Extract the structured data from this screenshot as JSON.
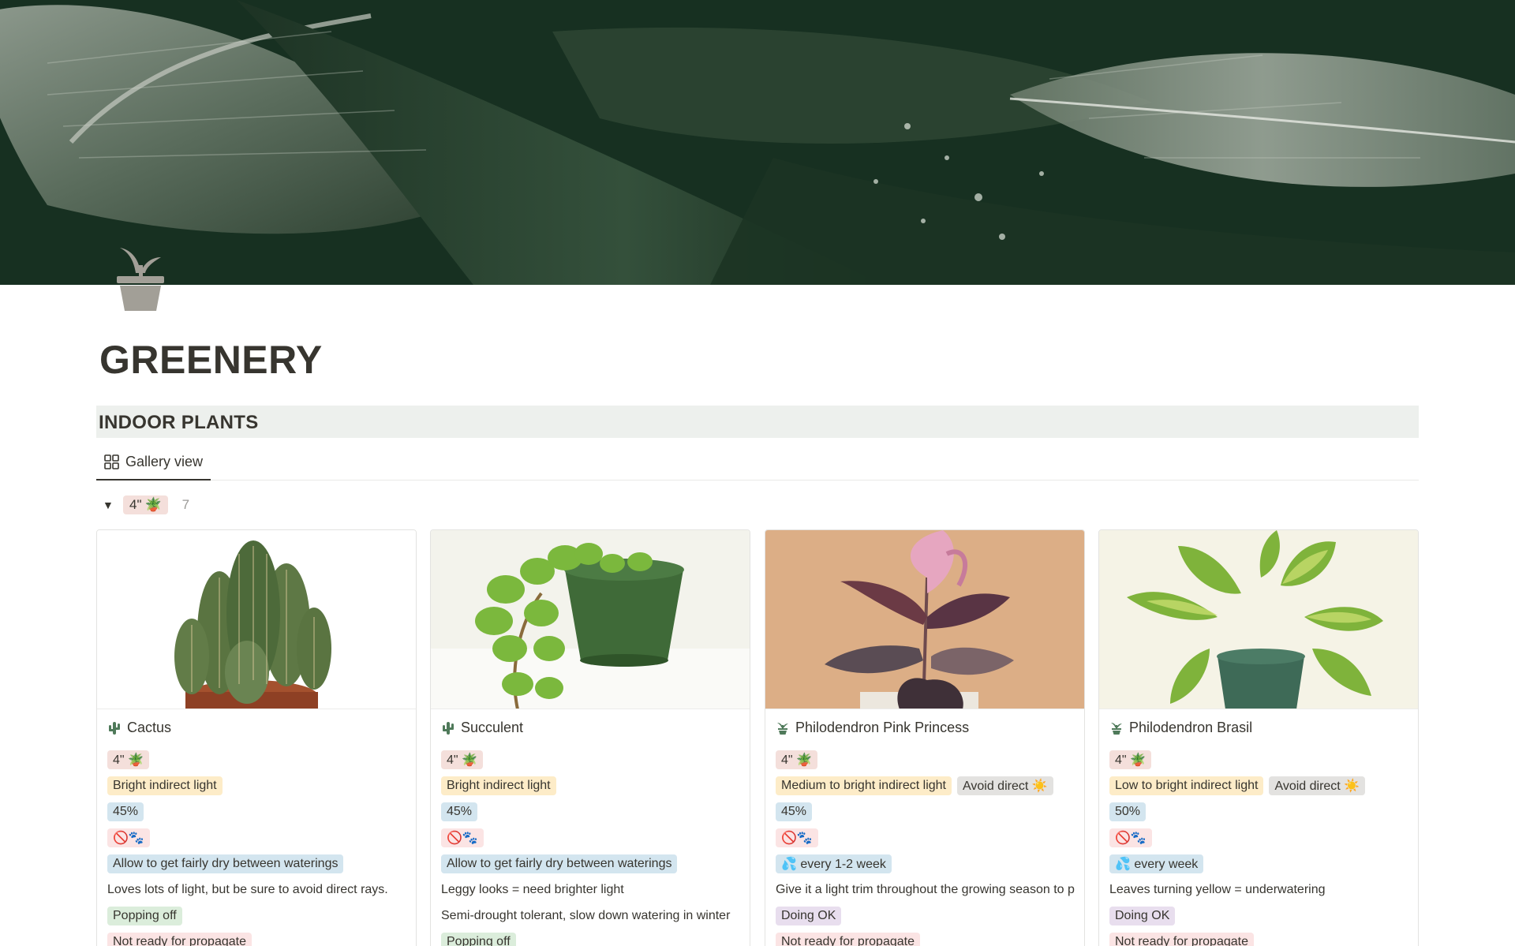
{
  "page": {
    "title": "GREENERY",
    "icon": "potted-plant-icon"
  },
  "section": {
    "heading": "INDOOR PLANTS"
  },
  "view": {
    "tab_label": "Gallery view",
    "tab_icon": "gallery-grid-icon"
  },
  "group": {
    "label": "4\"",
    "emoji": "🪴",
    "count": "7"
  },
  "cards": [
    {
      "name": "Cactus",
      "icon": "cactus-icon",
      "size": "4\" 🪴",
      "light": "Bright indirect light",
      "humidity": "45%",
      "pets": "🚫🐾",
      "water": "Allow to get fairly dry between waterings",
      "note1": "Loves lots of light, but be sure to avoid direct rays.",
      "status": "Popping off",
      "propagate": "Not ready for propagate"
    },
    {
      "name": "Succulent",
      "icon": "cactus-icon",
      "size": "4\" 🪴",
      "light": "Bright indirect light",
      "humidity": "45%",
      "pets": "🚫🐾",
      "water": "Allow to get fairly dry between waterings",
      "note1": "Leggy looks = need brighter light",
      "note2": "Semi-drought tolerant, slow down watering in winter",
      "status": "Popping off"
    },
    {
      "name": "Philodendron Pink Princess",
      "icon": "potted-plant-icon",
      "size": "4\" 🪴",
      "light": "Medium to bright indirect light",
      "light_extra": "Avoid direct ☀️",
      "humidity": "45%",
      "pets": "🚫🐾",
      "water": "💦 every 1-2 week",
      "note1": "Give it a light trim throughout the growing season to p",
      "status": "Doing OK",
      "propagate": "Not ready for propagate"
    },
    {
      "name": "Philodendron Brasil",
      "icon": "potted-plant-icon",
      "size": "4\" 🪴",
      "light": "Low to bright indirect light",
      "light_extra": "Avoid direct ☀️",
      "humidity": "50%",
      "pets": "🚫🐾",
      "water": "💦 every week",
      "note1": "Leaves turning yellow = underwatering",
      "status": "Doing OK",
      "propagate": "Not ready for propagate"
    }
  ],
  "colors": {
    "cover_dark": "#12261a",
    "section_bg": "#edf0ed",
    "tag_light": "#fdecc8",
    "tag_humidity": "#d3e5ef",
    "tag_pets": "#fbe4e4",
    "tag_status_good": "#dbeddb",
    "tag_status_ok": "#e8deee"
  }
}
